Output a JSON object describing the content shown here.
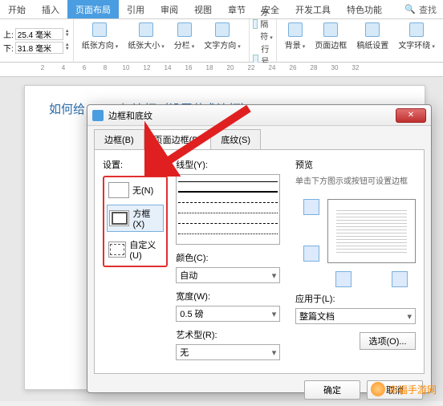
{
  "ribbon": {
    "tabs": [
      "开始",
      "插入",
      "页面布局",
      "引用",
      "审阅",
      "视图",
      "章节",
      "安全",
      "开发工具",
      "特色功能"
    ],
    "active_index": 2,
    "search": "查找"
  },
  "margins": {
    "top_label": "上:",
    "top_value": "25.4 毫米",
    "bottom_label": "下:",
    "bottom_value": "31.8 毫米"
  },
  "toolbar": {
    "orientation": "纸张方向",
    "size": "纸张大小",
    "columns": "分栏",
    "textdir": "文字方向",
    "breaks": "分隔符",
    "linenum": "行号",
    "bg": "背景",
    "pageborder": "页面边框",
    "manuscript": "稿纸设置",
    "textwrap": "文字环绕"
  },
  "ruler": [
    "2",
    "4",
    "6",
    "8",
    "10",
    "12",
    "14",
    "16",
    "18",
    "20",
    "22",
    "24",
    "26",
    "28",
    "30",
    "32"
  ],
  "document": {
    "title": "如何给 Word 加边框（设置艺术边框）"
  },
  "dialog": {
    "title": "边框和底纹",
    "tabs": {
      "border": "边框(B)",
      "pageborder": "页面边框(P)",
      "shading": "底纹(S)"
    },
    "settings_label": "设置:",
    "none": "无(N)",
    "box": "方框(X)",
    "custom": "自定义(U)",
    "linestyle_label": "线型(Y):",
    "color_label": "颜色(C):",
    "color_value": "自动",
    "width_label": "宽度(W):",
    "width_value": "0.5  磅",
    "art_label": "艺术型(R):",
    "art_value": "无",
    "preview_label": "预览",
    "preview_hint": "单击下方图示或按钮可设置边框",
    "apply_label": "应用于(L):",
    "apply_value": "整篇文档",
    "options": "选项(O)...",
    "ok": "确定",
    "cancel": "取消"
  },
  "watermark": "幸福手游网"
}
